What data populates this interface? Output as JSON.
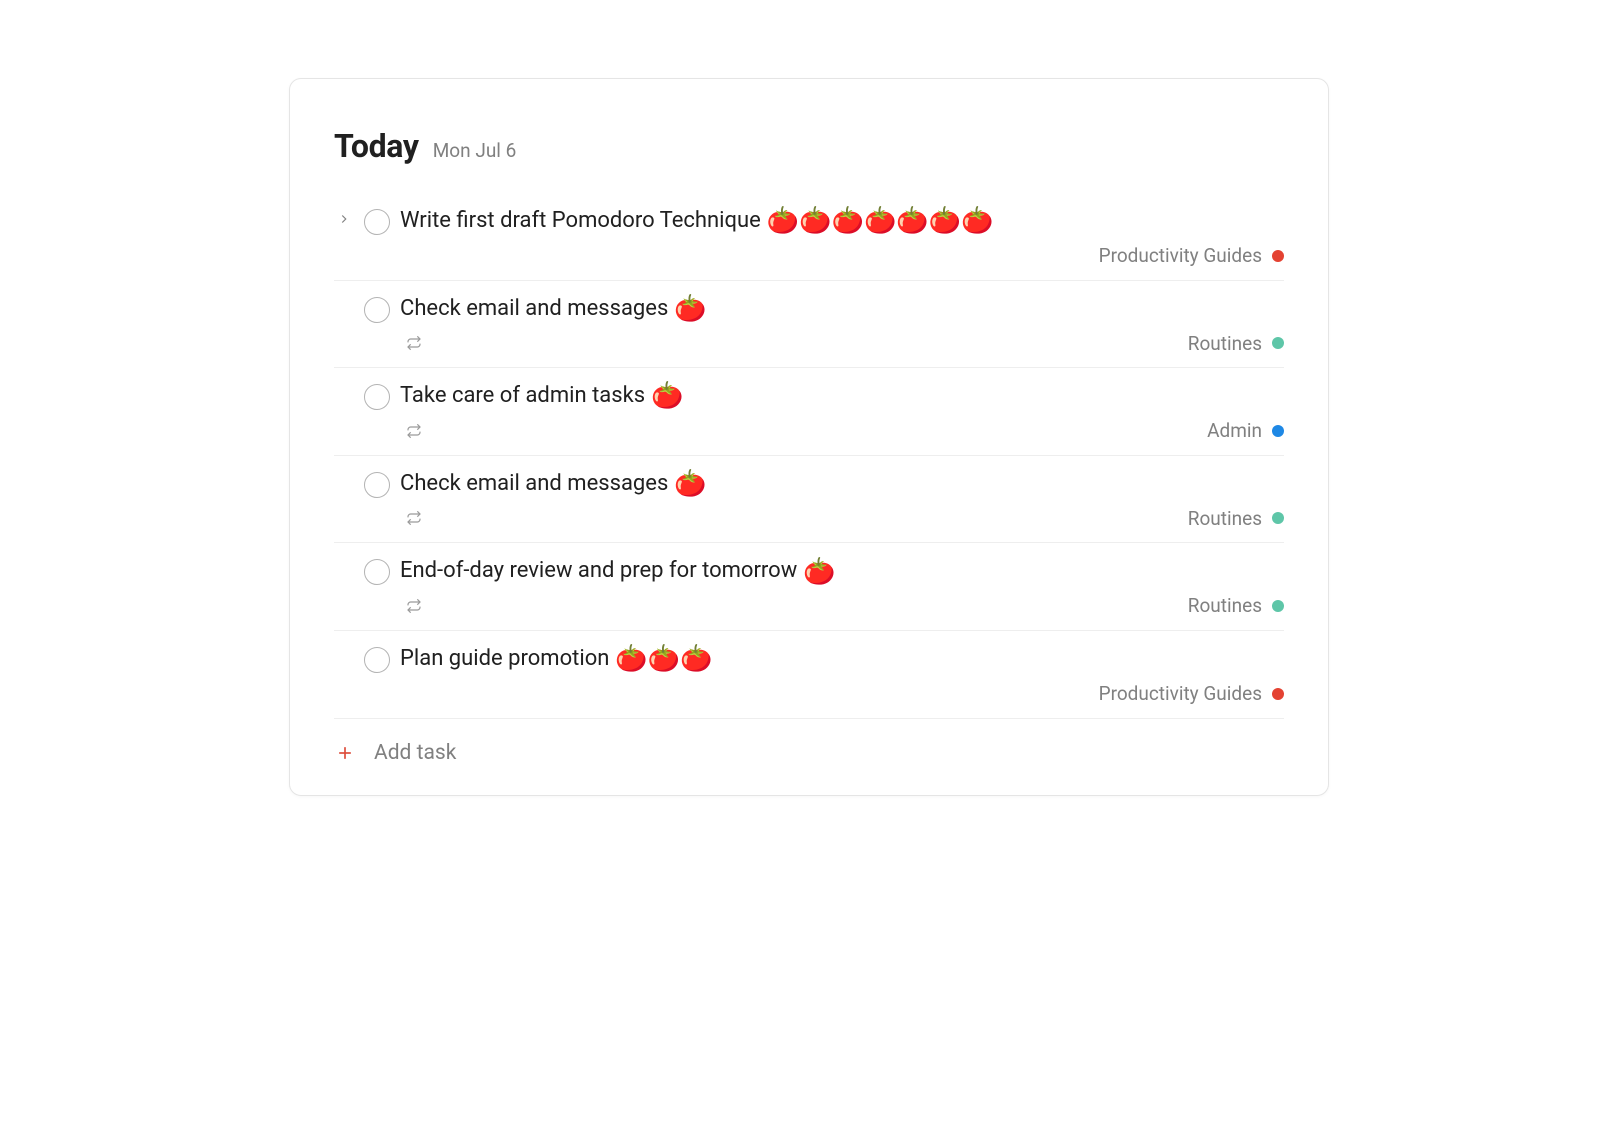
{
  "header": {
    "title": "Today",
    "date": "Mon Jul 6"
  },
  "tasks": [
    {
      "title": "Write first draft Pomodoro Technique",
      "tomatoes": 7,
      "recurring": false,
      "expandable": true,
      "project": {
        "name": "Productivity Guides",
        "color": "#e44232"
      }
    },
    {
      "title": "Check email and messages",
      "tomatoes": 1,
      "recurring": true,
      "expandable": false,
      "project": {
        "name": "Routines",
        "color": "#5ec6a8"
      }
    },
    {
      "title": "Take care of admin tasks",
      "tomatoes": 1,
      "recurring": true,
      "expandable": false,
      "project": {
        "name": "Admin",
        "color": "#1e88e5"
      }
    },
    {
      "title": "Check email and messages",
      "tomatoes": 1,
      "recurring": true,
      "expandable": false,
      "project": {
        "name": "Routines",
        "color": "#5ec6a8"
      }
    },
    {
      "title": "End-of-day review and prep for tomorrow",
      "tomatoes": 1,
      "recurring": true,
      "expandable": false,
      "project": {
        "name": "Routines",
        "color": "#5ec6a8"
      }
    },
    {
      "title": "Plan guide promotion",
      "tomatoes": 3,
      "recurring": false,
      "expandable": false,
      "project": {
        "name": "Productivity Guides",
        "color": "#e44232"
      }
    }
  ],
  "add_task": {
    "label": "Add task"
  },
  "icons": {
    "tomato": "🍅"
  }
}
